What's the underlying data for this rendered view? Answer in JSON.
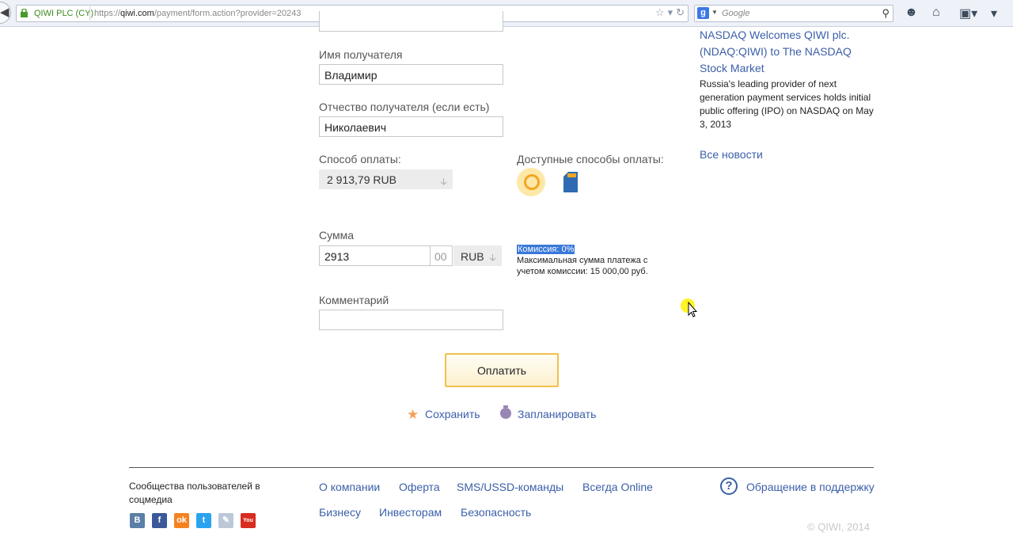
{
  "browser": {
    "identity": "QIWI PLC (CY)",
    "url_prefix": "https://",
    "url_domain": "qiwi.com",
    "url_path": "/payment/form.action?provider=20243",
    "search_placeholder": "Google"
  },
  "form": {
    "recipient_name": {
      "label": "Имя получателя",
      "value": "Владимир"
    },
    "recipient_patronymic": {
      "label": "Отчество получателя (если есть)",
      "value": "Николаевич"
    },
    "payment_method": {
      "label": "Способ оплаты:",
      "value": "2 913,79 RUB"
    },
    "available_methods_label": "Доступные способы оплаты:",
    "amount": {
      "label": "Сумма",
      "value": "2913",
      "cents": "00",
      "currency": "RUB"
    },
    "commission": "Комиссия: 0%",
    "commission_note": "Максимальная сумма платежа с учетом комиссии: 15 000,00 руб.",
    "comment": {
      "label": "Комментарий",
      "value": ""
    },
    "pay_button": "Оплатить",
    "save_link": "Сохранить",
    "schedule_link": "Запланировать"
  },
  "news": {
    "title": "NASDAQ Welcomes QIWI plc. (NDAQ:QIWI) to The NASDAQ Stock Market",
    "text": "Russia's leading provider of next generation payment services holds initial public offering (IPO) on NASDAQ on May 3, 2013",
    "all_news": "Все новости"
  },
  "footer": {
    "community": "Сообщества пользователей в соцмедиа",
    "links_row1": [
      "О компании",
      "Оферта",
      "SMS/USSD-команды",
      "Всегда Online"
    ],
    "links_row2": [
      "Бизнесу",
      "Инвесторам",
      "Безопасность"
    ],
    "support": "Обращение в поддержку",
    "copyright": "© QIWI, 2014",
    "social": [
      {
        "name": "vk-icon",
        "glyph": "B",
        "color": "#5b7fa6"
      },
      {
        "name": "facebook-icon",
        "glyph": "f",
        "color": "#3b5998"
      },
      {
        "name": "odnoklassniki-icon",
        "glyph": "ok",
        "color": "#f58220"
      },
      {
        "name": "twitter-icon",
        "glyph": "t",
        "color": "#2aa3ef"
      },
      {
        "name": "livejournal-icon",
        "glyph": "✎",
        "color": "#bcc8d8"
      },
      {
        "name": "youtube-icon",
        "glyph": "You",
        "color": "#d92c20"
      }
    ]
  },
  "colors": {
    "link": "#3b5fa8",
    "accent": "#f2c04a",
    "highlight": "#3a78d9"
  }
}
